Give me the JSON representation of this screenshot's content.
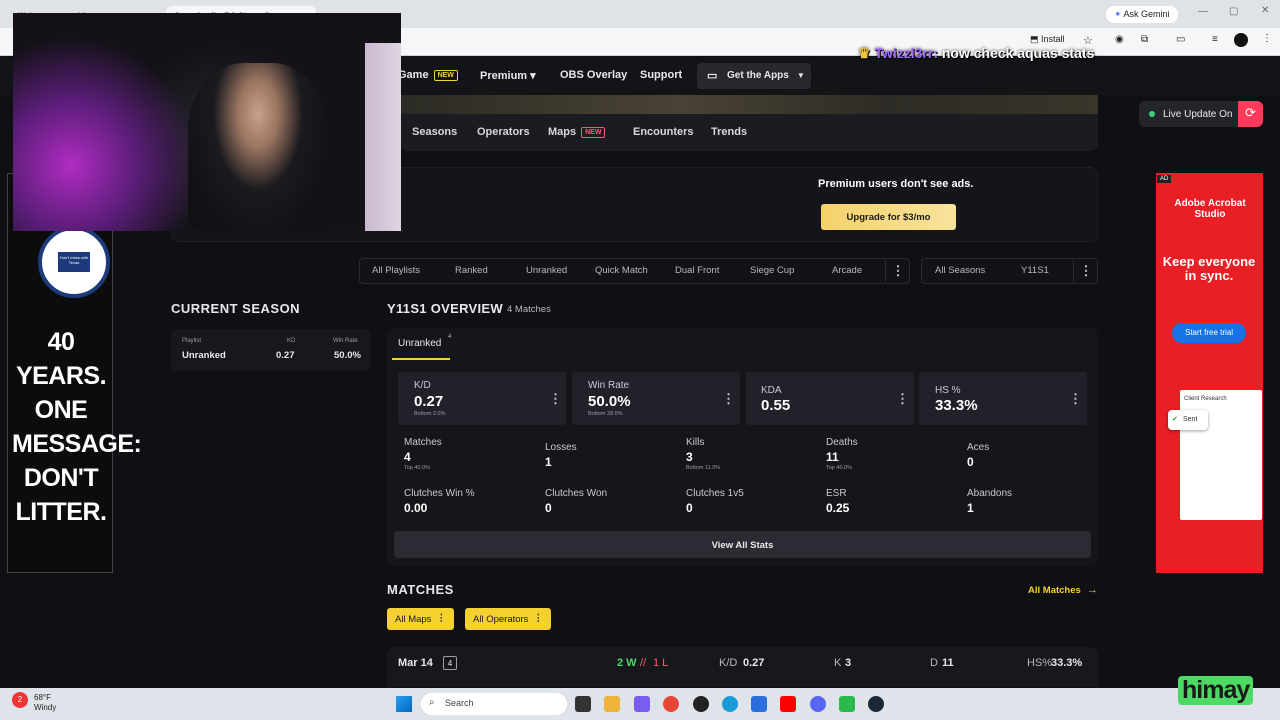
{
  "browser": {
    "tabs": [
      "(9) Instagram · Messages",
      "Stats for Jin R6 Siege Operator"
    ],
    "ask_gemini": "Ask Gemini",
    "install": "Install"
  },
  "stream_overlay": {
    "chat_user": "Twizzl3rr:",
    "chat_message": "now check aquas stats",
    "streamer_logo": "himay"
  },
  "site_nav": {
    "items": [
      {
        "label": "Game",
        "badge": "NEW"
      },
      {
        "label": "Premium ▾"
      },
      {
        "label": "OBS Overlay"
      },
      {
        "label": "Support"
      }
    ],
    "get_apps": "Get the Apps"
  },
  "sub_nav": {
    "items": [
      {
        "label": "Seasons"
      },
      {
        "label": "Operators"
      },
      {
        "label": "Maps",
        "badge": "NEW"
      },
      {
        "label": "Encounters"
      },
      {
        "label": "Trends"
      }
    ],
    "live_update": "Live Update On"
  },
  "premium": {
    "text": "Premium users don't see ads.",
    "button": "Upgrade for $3/mo"
  },
  "filters": {
    "playlists": [
      "All Playlists",
      "Ranked",
      "Unranked",
      "Quick Match",
      "Dual Front",
      "Siege Cup",
      "Arcade"
    ],
    "seasons": [
      "All Seasons",
      "Y11S1"
    ]
  },
  "current_season": {
    "title": "CURRENT SEASON",
    "headers": {
      "playlist": "Playlist",
      "kd": "KD",
      "win_rate": "Win Rate"
    },
    "row": {
      "playlist": "Unranked",
      "kd": "0.27",
      "win_rate": "50.0%"
    }
  },
  "overview": {
    "title": "Y11S1 OVERVIEW",
    "count": "4 Matches",
    "tab": "Unranked",
    "tab_count": "4",
    "cards": [
      {
        "title": "K/D",
        "value": "0.27",
        "sub": "Bottom 2.0%"
      },
      {
        "title": "Win Rate",
        "value": "50.0%",
        "sub": "Bottom 28.0%"
      },
      {
        "title": "KDA",
        "value": "0.55",
        "sub": ""
      },
      {
        "title": "HS %",
        "value": "33.3%",
        "sub": ""
      }
    ],
    "stats": [
      {
        "label": "Matches",
        "value": "4",
        "sub": "Top 40.0%"
      },
      {
        "label": "Losses",
        "value": "1",
        "sub": ""
      },
      {
        "label": "Kills",
        "value": "3",
        "sub": "Bottom 11.0%"
      },
      {
        "label": "Deaths",
        "value": "11",
        "sub": "Top 40.0%"
      },
      {
        "label": "Aces",
        "value": "0",
        "sub": ""
      },
      {
        "label": "Clutches Win %",
        "value": "0.00",
        "sub": ""
      },
      {
        "label": "Clutches Won",
        "value": "0",
        "sub": ""
      },
      {
        "label": "Clutches 1v5",
        "value": "0",
        "sub": ""
      },
      {
        "label": "ESR",
        "value": "0.25",
        "sub": ""
      },
      {
        "label": "Abandons",
        "value": "1",
        "sub": ""
      }
    ],
    "view_all": "View All Stats"
  },
  "matches": {
    "title": "MATCHES",
    "all_matches": "All Matches",
    "filters": [
      "All Maps",
      "All Operators"
    ],
    "row": {
      "date": "Mar 14",
      "count": "4",
      "wins": "2 W",
      "sep": "//",
      "losses": "1 L",
      "kd_label": "K/D",
      "kd": "0.27",
      "k_label": "K",
      "k": "3",
      "d_label": "D",
      "d": "11",
      "hs_label": "HS%",
      "hs": "33.3%"
    }
  },
  "ads": {
    "left": {
      "seal_text": "CELEBRATING 40 YEARS · MEANS DON'T LITTER",
      "seal_center": "Don't mess with Texas",
      "headline": "40 YEARS. ONE MESSAGE: DON'T LITTER."
    },
    "right": {
      "tag": "AD",
      "brand": "Adobe Acrobat Studio",
      "headline": "Keep everyone in sync.",
      "cta": "Start free trial",
      "doc_title": "Client Research",
      "sent": "Sent"
    }
  },
  "taskbar": {
    "temp": "68°F",
    "weather": "Windy",
    "notification_count": "2",
    "search": "Search"
  },
  "colors": {
    "accent_yellow": "#f5d130",
    "win_green": "#4cd964",
    "loss_red": "#ff5a6e"
  }
}
